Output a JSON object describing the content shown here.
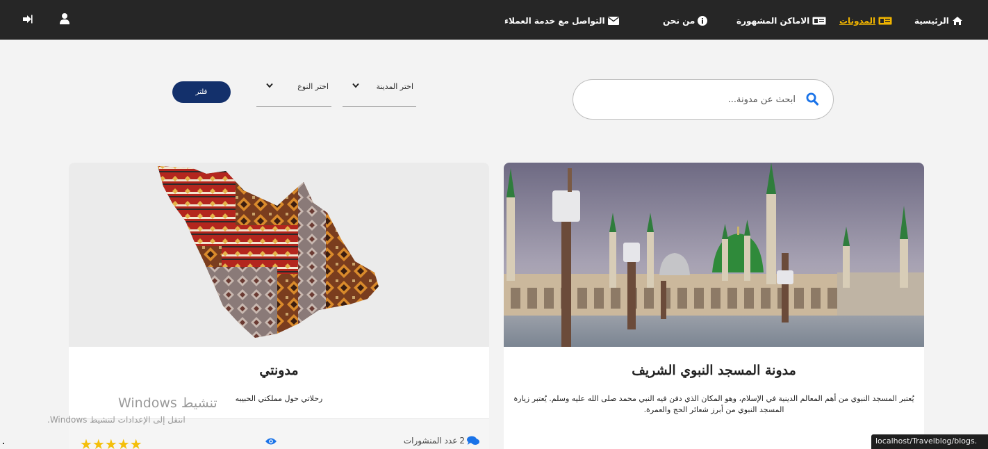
{
  "nav": {
    "items": [
      {
        "label": "الرئيسية",
        "icon": "home-icon"
      },
      {
        "label": "المدونات",
        "icon": "blog-icon",
        "active": true
      },
      {
        "label": "الاماكن المشهورة",
        "icon": "places-icon"
      },
      {
        "label": "من نحن",
        "icon": "info-icon"
      },
      {
        "label": "التواصل مع خدمة العملاء",
        "icon": "envelope-icon"
      }
    ],
    "right_icons": [
      "logout-icon",
      "user-icon"
    ],
    "active_color": "#f0b400"
  },
  "search": {
    "placeholder": "ابحث عن مدونة..."
  },
  "filters": {
    "city_select": "اختر المدينة",
    "type_select": "اختر النوع",
    "filter_button": "فلتر"
  },
  "cards": [
    {
      "title": "مدونة المسجد النبوي الشريف",
      "text": "يُعتبر المسجد النبوي من أهم المعالم الدينية في الإسلام، وهو المكان الذي دفن فيه النبي محمد صلى الله عليه وسلم. يُعتبر زيارة المسجد النبوي من أبرز شعائر الحج والعمرة.",
      "image": "mosque-photo"
    },
    {
      "title": "مدونتي",
      "text": "رحلاتي حول مملكتي الحبيبه",
      "image": "saudi-map-pattern",
      "posts_count": "2",
      "posts_label": "عدد المنشورات",
      "rating_stars": 5
    }
  ],
  "watermark": {
    "line1": "تنشيط Windows",
    "line2": "انتقل إلى الإعدادات لتنشيط Windows."
  },
  "status_url": "localhost/Travelblog/blogs."
}
